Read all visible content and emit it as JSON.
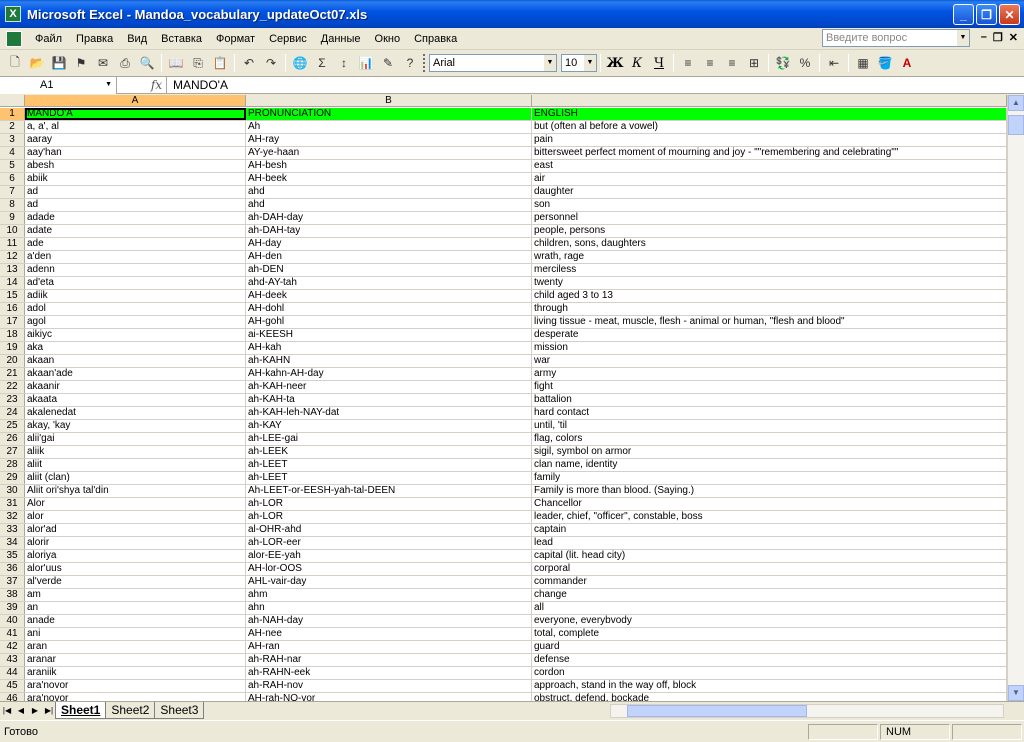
{
  "window": {
    "title": "Microsoft Excel - Mandoa_vocabulary_updateOct07.xls"
  },
  "menu": {
    "items": [
      "Файл",
      "Правка",
      "Вид",
      "Вставка",
      "Формат",
      "Сервис",
      "Данные",
      "Окно",
      "Справка"
    ],
    "help_placeholder": "Введите вопрос"
  },
  "toolbar": {
    "font_name": "Arial",
    "font_size": "10"
  },
  "formula_bar": {
    "cell_ref": "A1",
    "fx": "fx",
    "value": "MANDO'A"
  },
  "columns": [
    "A",
    "B"
  ],
  "rows": [
    {
      "n": "1",
      "a": "MANDO'A",
      "b": "PRONUNCIATION",
      "c": "ENGLISH"
    },
    {
      "n": "2",
      "a": "a, a', al",
      "b": "Ah",
      "c": "but (often al before a vowel)"
    },
    {
      "n": "3",
      "a": "aaray",
      "b": "AH-ray",
      "c": "pain"
    },
    {
      "n": "4",
      "a": "aay'han",
      "b": "AY-ye-haan",
      "c": "bittersweet perfect moment of mourning and joy - \"\"remembering and celebrating\"\""
    },
    {
      "n": "5",
      "a": "abesh",
      "b": "AH-besh",
      "c": "east"
    },
    {
      "n": "6",
      "a": "abiik",
      "b": "AH-beek",
      "c": "air"
    },
    {
      "n": "7",
      "a": "ad",
      "b": "ahd",
      "c": "daughter"
    },
    {
      "n": "8",
      "a": "ad",
      "b": "ahd",
      "c": "son"
    },
    {
      "n": "9",
      "a": "adade",
      "b": "ah-DAH-day",
      "c": "personnel"
    },
    {
      "n": "10",
      "a": "adate",
      "b": "ah-DAH-tay",
      "c": "people, persons"
    },
    {
      "n": "11",
      "a": "ade",
      "b": "AH-day",
      "c": "children, sons, daughters"
    },
    {
      "n": "12",
      "a": "a'den",
      "b": "AH-den",
      "c": "wrath, rage"
    },
    {
      "n": "13",
      "a": "adenn",
      "b": "ah-DEN",
      "c": "merciless"
    },
    {
      "n": "14",
      "a": "ad'eta",
      "b": "ahd-AY-tah",
      "c": "twenty"
    },
    {
      "n": "15",
      "a": "adiik",
      "b": "AH-deek",
      "c": "child aged 3 to 13"
    },
    {
      "n": "16",
      "a": "adol",
      "b": "AH-dohl",
      "c": "through"
    },
    {
      "n": "17",
      "a": "agol",
      "b": "AH-gohl",
      "c": "living tissue - meat, muscle, flesh - animal or human,  \"flesh and blood\""
    },
    {
      "n": "18",
      "a": "aikiyc",
      "b": "ai-KEESH",
      "c": "desperate"
    },
    {
      "n": "19",
      "a": "aka",
      "b": "AH-kah",
      "c": "mission"
    },
    {
      "n": "20",
      "a": "akaan",
      "b": "ah-KAHN",
      "c": "war"
    },
    {
      "n": "21",
      "a": "akaan'ade",
      "b": "AH-kahn-AH-day",
      "c": "army"
    },
    {
      "n": "22",
      "a": "akaanir",
      "b": "ah-KAH-neer",
      "c": "fight"
    },
    {
      "n": "23",
      "a": "akaata",
      "b": "ah-KAH-ta",
      "c": "battalion"
    },
    {
      "n": "24",
      "a": "akalenedat",
      "b": "ah-KAH-leh-NAY-dat",
      "c": "hard contact"
    },
    {
      "n": "25",
      "a": "akay, 'kay",
      "b": "ah-KAY",
      "c": "until, 'til"
    },
    {
      "n": "26",
      "a": "alii'gai",
      "b": "ah-LEE-gai",
      "c": "flag, colors"
    },
    {
      "n": "27",
      "a": "aliik",
      "b": "ah-LEEK",
      "c": "sigil, symbol on armor"
    },
    {
      "n": "28",
      "a": "aliit",
      "b": "ah-LEET",
      "c": "clan name, identity"
    },
    {
      "n": "29",
      "a": "aliit (clan)",
      "b": "ah-LEET",
      "c": "family"
    },
    {
      "n": "30",
      "a": "Aliit ori'shya tal'din",
      "b": "Ah-LEET-or-EESH-yah-tal-DEEN",
      "c": "Family is more than blood. (Saying.)"
    },
    {
      "n": "31",
      "a": "Alor",
      "b": "ah-LOR",
      "c": "Chancellor"
    },
    {
      "n": "32",
      "a": "alor",
      "b": "ah-LOR",
      "c": "leader, chief, \"officer\", constable, boss"
    },
    {
      "n": "33",
      "a": "alor'ad",
      "b": "al-OHR-ahd",
      "c": "captain"
    },
    {
      "n": "34",
      "a": "alorir",
      "b": "ah-LOR-eer",
      "c": "lead"
    },
    {
      "n": "35",
      "a": "aloriya",
      "b": "alor-EE-yah",
      "c": "capital (lit. head city)"
    },
    {
      "n": "36",
      "a": "alor'uus",
      "b": "AH-lor-OOS",
      "c": "corporal"
    },
    {
      "n": "37",
      "a": "al'verde",
      "b": "AHL-vair-day",
      "c": "commander"
    },
    {
      "n": "38",
      "a": "am",
      "b": "ahm",
      "c": "change"
    },
    {
      "n": "39",
      "a": "an",
      "b": "ahn",
      "c": "all"
    },
    {
      "n": "40",
      "a": "anade",
      "b": "ah-NAH-day",
      "c": "everyone, everybvody"
    },
    {
      "n": "41",
      "a": "ani",
      "b": "AH-nee",
      "c": "total, complete"
    },
    {
      "n": "42",
      "a": "aran",
      "b": "AH-ran",
      "c": "guard"
    },
    {
      "n": "43",
      "a": "aranar",
      "b": "ah-RAH-nar",
      "c": "defense"
    },
    {
      "n": "44",
      "a": "araniik",
      "b": "ah-RAHN-eek",
      "c": "cordon"
    },
    {
      "n": "45",
      "a": "ara'novor",
      "b": "ah-RAH-nov",
      "c": "approach, stand in the way off, block"
    },
    {
      "n": "46",
      "a": "ara'novor",
      "b": "AH-rah-NO-vor",
      "c": "obstruct, defend, bockade"
    }
  ],
  "sheets": [
    "Sheet1",
    "Sheet2",
    "Sheet3"
  ],
  "status": {
    "text": "Готово",
    "num": "NUM"
  }
}
